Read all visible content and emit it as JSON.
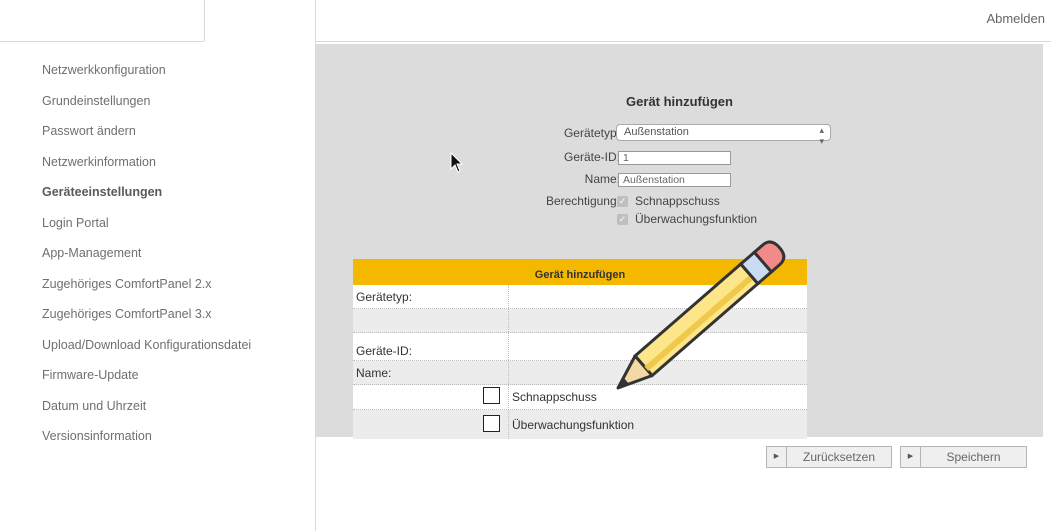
{
  "header": {
    "logout_label": "Abmelden"
  },
  "sidebar": {
    "items": [
      {
        "label": "Netzwerkkonfiguration",
        "active": false
      },
      {
        "label": "Grundeinstellungen",
        "active": false
      },
      {
        "label": "Passwort ändern",
        "active": false
      },
      {
        "label": "Netzwerkinformation",
        "active": false
      },
      {
        "label": "Geräteeinstellungen",
        "active": true
      },
      {
        "label": "Login Portal",
        "active": false
      },
      {
        "label": "App-Management",
        "active": false
      },
      {
        "label": "Zugehöriges ComfortPanel 2.x",
        "active": false
      },
      {
        "label": "Zugehöriges ComfortPanel 3.x",
        "active": false
      },
      {
        "label": "Upload/Download Konfigurationsdatei",
        "active": false
      },
      {
        "label": "Firmware-Update",
        "active": false
      },
      {
        "label": "Datum und Uhrzeit",
        "active": false
      },
      {
        "label": "Versionsinformation",
        "active": false
      }
    ]
  },
  "form": {
    "title": "Gerät hinzufügen",
    "device_type_label": "Gerätetyp:",
    "device_type_value": "Außenstation",
    "device_id_label": "Geräte-ID:",
    "device_id_value": "1",
    "name_label": "Name:",
    "name_value": "Außenstation",
    "permission_label": "Berechtigung:",
    "permissions": [
      {
        "label": "Schnappschuss",
        "checked": true
      },
      {
        "label": "Überwachungsfunktion",
        "checked": true
      }
    ]
  },
  "overlay": {
    "title": "Gerät hinzufügen",
    "rows": [
      {
        "label": "Gerätetyp:",
        "value": ""
      },
      {
        "label": "",
        "value": ""
      },
      {
        "label": "Geräte-ID:",
        "value": ""
      },
      {
        "label": "Name:",
        "value": ""
      }
    ],
    "checkboxes": [
      {
        "label": "Schnappschuss",
        "checked": false
      },
      {
        "label": "Überwachungsfunktion",
        "checked": false
      }
    ]
  },
  "buttons": {
    "reset_label": "Zurücksetzen",
    "save_label": "Speichern"
  },
  "colors": {
    "accent": "#f5b800",
    "panel": "#dcdcdc"
  }
}
